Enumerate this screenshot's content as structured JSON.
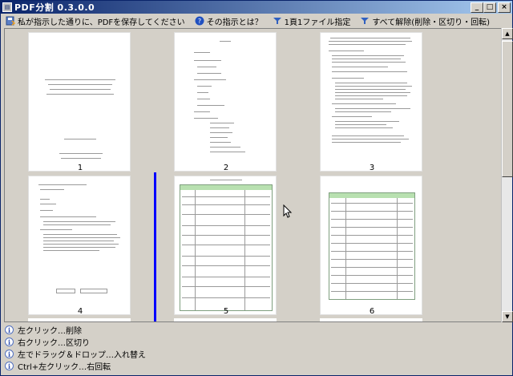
{
  "window": {
    "title": "PDF分割 0.3.0.0",
    "minimize": "_",
    "maximize": "□",
    "close": "×"
  },
  "toolbar": {
    "save_label": "私が指示した通りに、PDFを保存してください",
    "help_label": "その指示とは？",
    "one_page_label": "1頁1ファイル指定",
    "clear_label": "すべて解除(削除・区切り・回転)"
  },
  "pages": [
    {
      "number": "1"
    },
    {
      "number": "2"
    },
    {
      "number": "3"
    },
    {
      "number": "4"
    },
    {
      "number": "5"
    },
    {
      "number": "6"
    }
  ],
  "hints": [
    {
      "text": "左クリック…削除"
    },
    {
      "text": "右クリック…区切り"
    },
    {
      "text": "左でドラッグ＆ドロップ…入れ替え"
    },
    {
      "text": "Ctrl+左クリック…右回転"
    }
  ],
  "colors": {
    "accent": "#0a246a",
    "separator": "#0000ff",
    "table_header": "#b8e0b0"
  }
}
